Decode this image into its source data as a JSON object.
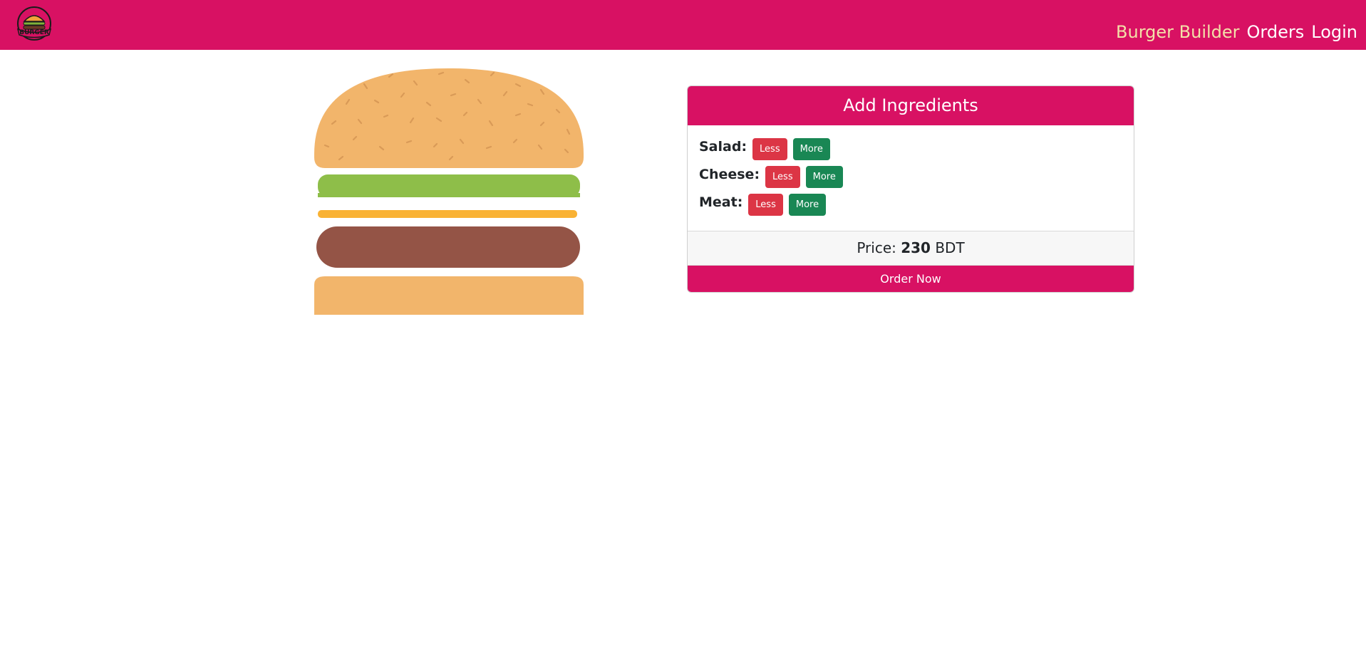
{
  "navbar": {
    "brand_color": "#d81163",
    "logo": {
      "icon": "burger-logo-icon",
      "text": "BURGER"
    },
    "links": [
      {
        "label": "Burger Builder",
        "active": true
      },
      {
        "label": "Orders",
        "active": false
      },
      {
        "label": "Login",
        "active": false
      }
    ]
  },
  "burger": {
    "layers": [
      "bread-top",
      "salad",
      "cheese",
      "meat",
      "bread-bottom"
    ],
    "colors": {
      "bread": "#f2b56b",
      "salad": "#8ebe49",
      "cheese": "#f9b234",
      "meat": "#945446",
      "seeds": "#d99a57"
    }
  },
  "controls": {
    "header": "Add Ingredients",
    "ingredients": [
      {
        "label": "Salad:",
        "less": "Less",
        "more": "More"
      },
      {
        "label": "Cheese:",
        "less": "Less",
        "more": "More"
      },
      {
        "label": "Meat:",
        "less": "Less",
        "more": "More"
      }
    ],
    "price": {
      "prefix": "Price:",
      "value": "230",
      "currency": "BDT"
    },
    "order_button": "Order Now",
    "colors": {
      "less": "#dc3545",
      "more": "#198754"
    }
  }
}
